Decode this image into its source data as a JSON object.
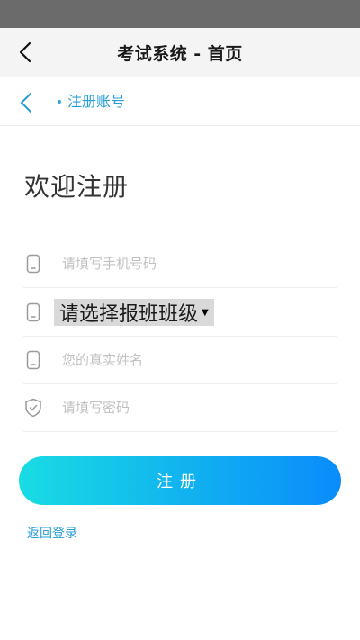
{
  "header": {
    "title": "考试系统 - 首页"
  },
  "sub_nav": {
    "title": "注册账号"
  },
  "page": {
    "welcome": "欢迎注册"
  },
  "form": {
    "phone_placeholder": "请填写手机号码",
    "class_select": "请选择报班班级",
    "name_placeholder": "您的真实姓名",
    "password_placeholder": "请填写密码"
  },
  "actions": {
    "register_label": "注册",
    "back_login_label": "返回登录"
  },
  "colors": {
    "accent": "#2a9fd6",
    "button_gradient_start": "#19dce3",
    "button_gradient_end": "#0a8cfb"
  },
  "icons": {
    "header_back": "chevron-left-icon",
    "subnav_back": "chevron-left-icon",
    "phone": "phone-icon",
    "class": "phone-icon",
    "name": "phone-icon",
    "password": "shield-check-icon"
  }
}
